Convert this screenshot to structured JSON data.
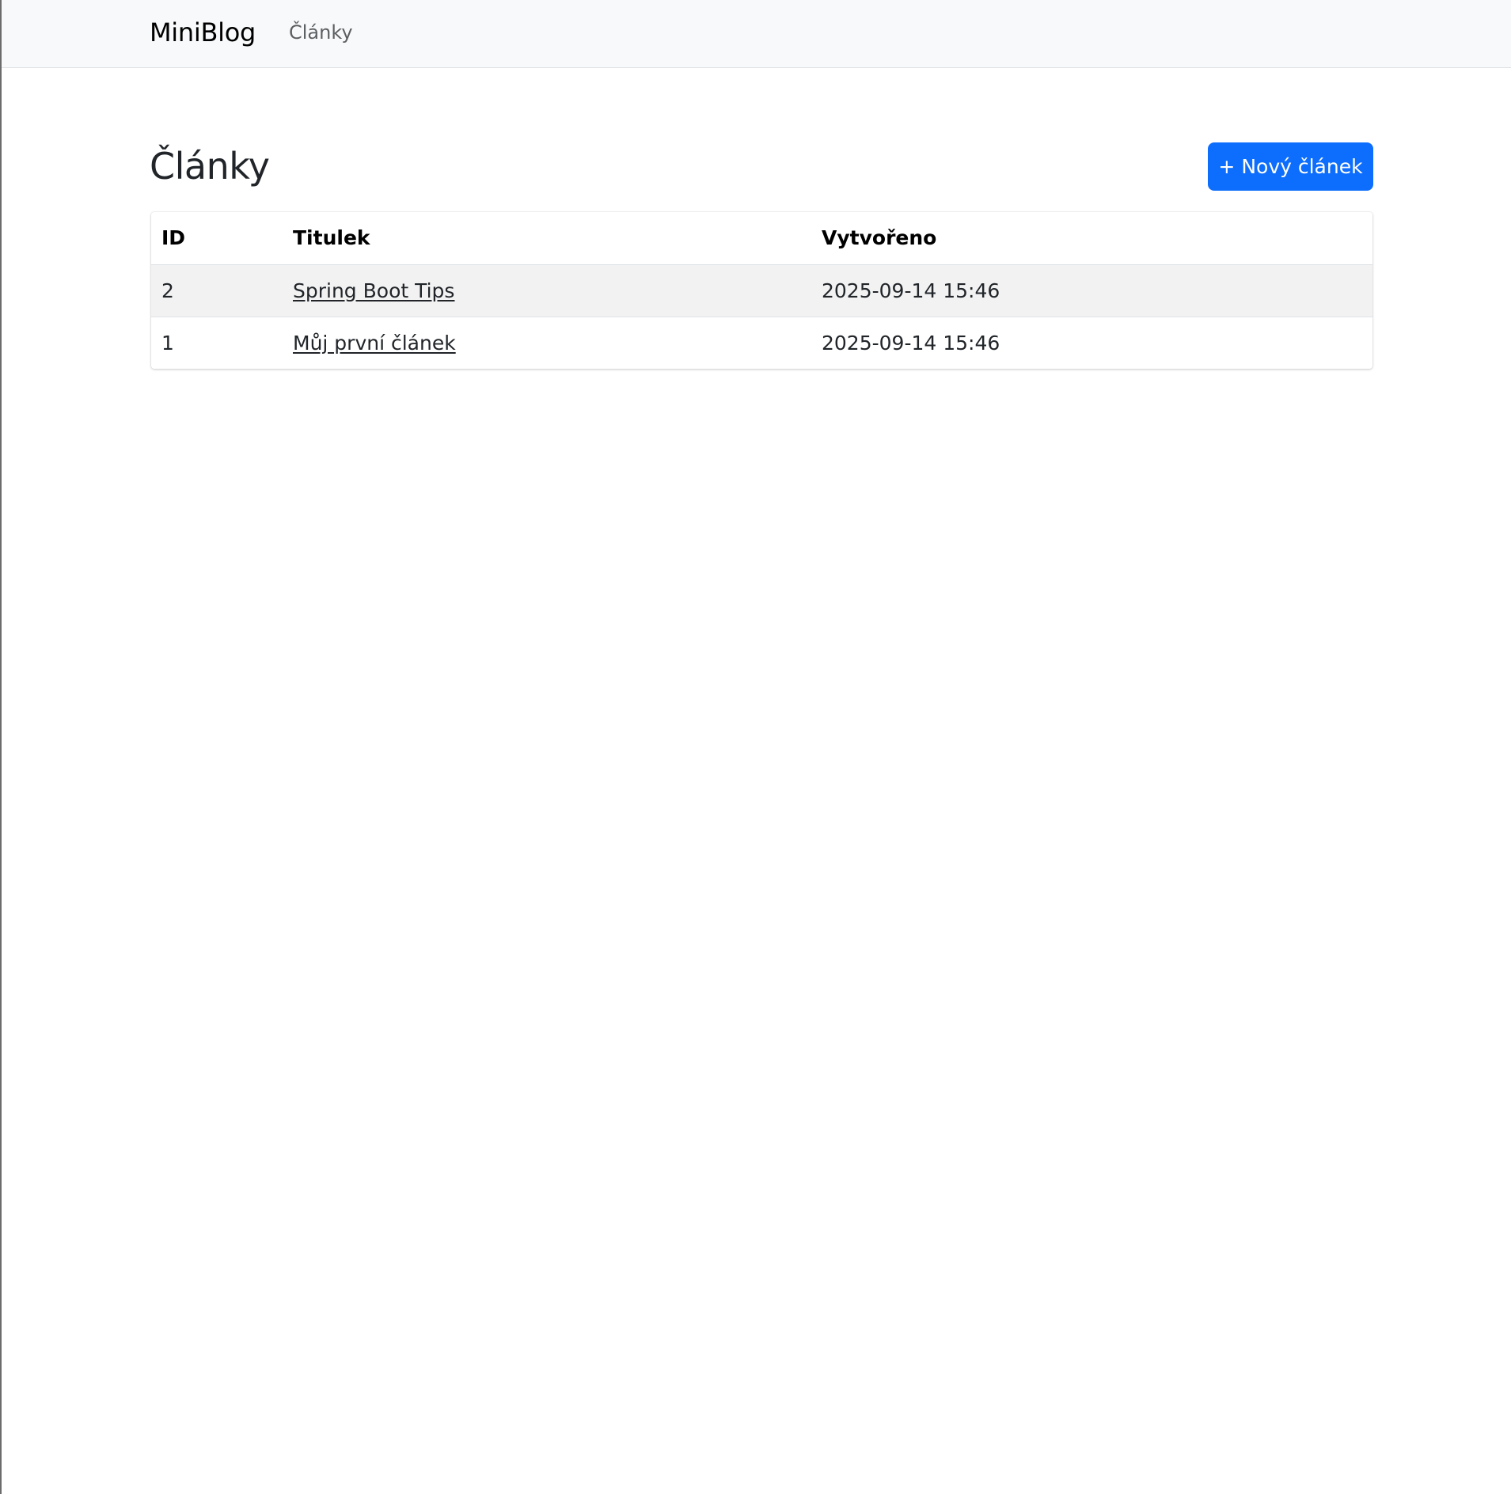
{
  "navbar": {
    "brand": "MiniBlog",
    "links": [
      {
        "label": "Články"
      }
    ]
  },
  "page": {
    "title": "Články",
    "new_button_label": "+ Nový článek"
  },
  "table": {
    "columns": [
      "ID",
      "Titulek",
      "Vytvořeno"
    ],
    "rows": [
      {
        "id": "2",
        "title": "Spring Boot Tips",
        "created": "2025-09-14 15:46"
      },
      {
        "id": "1",
        "title": "Můj první článek",
        "created": "2025-09-14 15:46"
      }
    ]
  },
  "colors": {
    "primary": "#0d6efd",
    "navbar_bg": "#f8f9fa",
    "stripe_bg": "#f2f2f2"
  }
}
